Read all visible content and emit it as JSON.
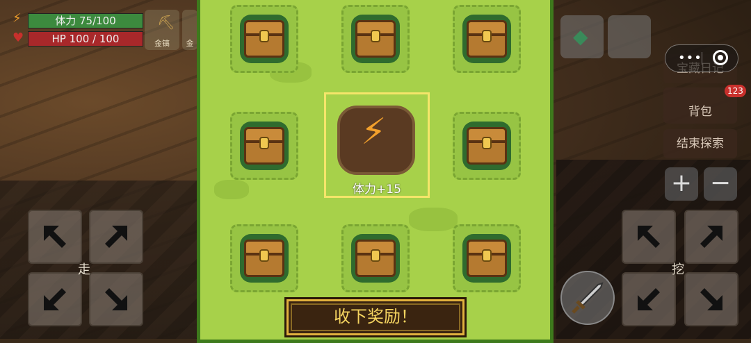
{
  "hud": {
    "stamina": "体力 75/100",
    "hp": "HP 100 / 100",
    "tools": [
      "金镐",
      "金"
    ]
  },
  "side": {
    "treasure_log": "宝藏日记",
    "backpack": "背包",
    "backpack_badge": "123",
    "end_explore": "结束探索",
    "zoom_in": "+",
    "zoom_out": "−"
  },
  "controls": {
    "walk_label": "走",
    "dig_label": "挖"
  },
  "reward": {
    "text": "体力+15",
    "claim_button": "收下奖励！"
  },
  "colors": {
    "panel_bg": "#a7d14a",
    "panel_border": "#3e7a1c",
    "highlight": "#f5e56a",
    "button_text": "#f5d460"
  },
  "icons": {
    "stamina": "lightning-icon",
    "hp": "heart-icon",
    "chest": "treasure-chest-icon",
    "reward": "lightning-icon"
  }
}
